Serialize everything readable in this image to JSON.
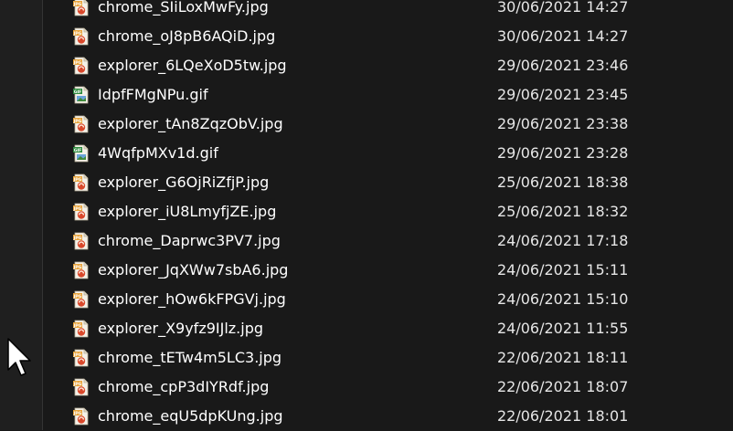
{
  "files": [
    {
      "name": "chrome_SIiLoxMwFy.jpg",
      "date": "30/06/2021 14:27",
      "icon": "jpg-image-icon"
    },
    {
      "name": "chrome_oJ8pB6AQiD.jpg",
      "date": "30/06/2021 14:27",
      "icon": "jpg-image-icon"
    },
    {
      "name": "explorer_6LQeXoD5tw.jpg",
      "date": "29/06/2021 23:46",
      "icon": "jpg-image-icon"
    },
    {
      "name": "IdpfFMgNPu.gif",
      "date": "29/06/2021 23:45",
      "icon": "gif-image-icon"
    },
    {
      "name": "explorer_tAn8ZqzObV.jpg",
      "date": "29/06/2021 23:38",
      "icon": "jpg-image-icon"
    },
    {
      "name": "4WqfpMXv1d.gif",
      "date": "29/06/2021 23:28",
      "icon": "gif-image-icon"
    },
    {
      "name": "explorer_G6OjRiZfjP.jpg",
      "date": "25/06/2021 18:38",
      "icon": "jpg-image-icon"
    },
    {
      "name": "explorer_iU8LmyfjZE.jpg",
      "date": "25/06/2021 18:32",
      "icon": "jpg-image-icon"
    },
    {
      "name": "chrome_Daprwc3PV7.jpg",
      "date": "24/06/2021 17:18",
      "icon": "jpg-image-icon"
    },
    {
      "name": "explorer_JqXWw7sbA6.jpg",
      "date": "24/06/2021 15:11",
      "icon": "jpg-image-icon"
    },
    {
      "name": "explorer_hOw6kFPGVj.jpg",
      "date": "24/06/2021 15:10",
      "icon": "jpg-image-icon"
    },
    {
      "name": "explorer_X9yfz9IJlz.jpg",
      "date": "24/06/2021 11:55",
      "icon": "jpg-image-icon"
    },
    {
      "name": "chrome_tETw4m5LC3.jpg",
      "date": "22/06/2021 18:11",
      "icon": "jpg-image-icon"
    },
    {
      "name": "chrome_cpP3dIYRdf.jpg",
      "date": "22/06/2021 18:07",
      "icon": "jpg-image-icon"
    },
    {
      "name": "chrome_eqU5dpKUng.jpg",
      "date": "22/06/2021 18:01",
      "icon": "jpg-image-icon"
    }
  ],
  "icon_labels": {
    "jpg": "JPG",
    "gif": "GIF"
  },
  "colors": {
    "background": "#191919",
    "text": "#ffffff",
    "date_text": "#e6e6e6",
    "jpg_badge": "#e8a33a",
    "gif_badge": "#2e8b3e",
    "image_swirl": "#d9482b"
  }
}
